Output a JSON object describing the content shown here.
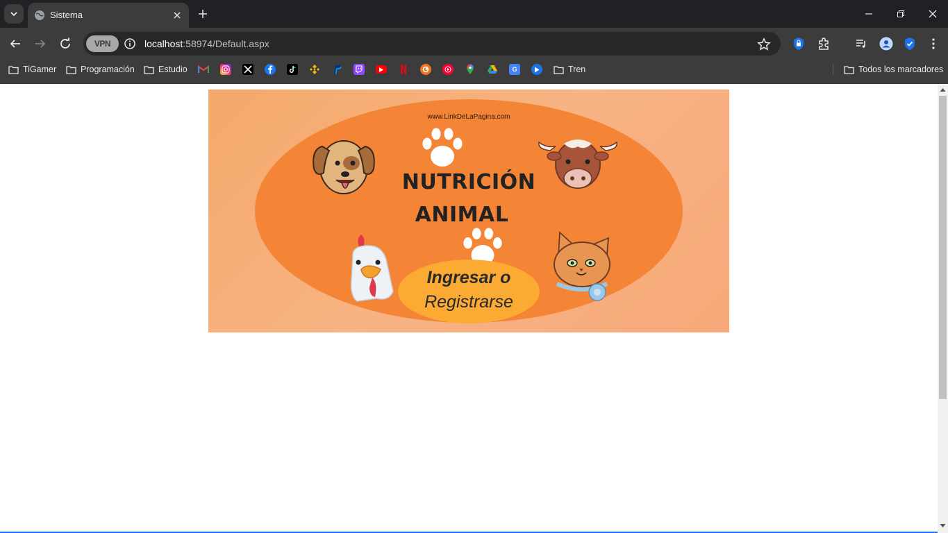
{
  "browser": {
    "tab": {
      "title": "Sistema"
    },
    "address": {
      "host": "localhost",
      "path": ":58974/Default.aspx"
    },
    "vpn_label": "VPN"
  },
  "bookmarks": {
    "folders": [
      "TiGamer",
      "Programación",
      "Estudio"
    ],
    "icons": [
      "gmail-icon",
      "instagram-icon",
      "x-icon",
      "facebook-icon",
      "tiktok-icon",
      "binance-icon",
      "paypal-icon",
      "twitch-icon",
      "youtube-icon",
      "netflix-icon",
      "crunchyroll-icon",
      "youtube-music-icon",
      "maps-icon",
      "drive-icon",
      "translate-icon",
      "play-icon"
    ],
    "tren": "Tren",
    "all": "Todos los marcadores"
  },
  "banner": {
    "site_link": "www.LinkDeLaPagina.com",
    "title_line1": "NUTRICIÓN",
    "title_line2": "ANIMAL",
    "cta_line1": "Ingresar o",
    "cta_line2": "Registrarse"
  },
  "colors": {
    "banner_bg": "#f8b383",
    "ellipse": "#f58536",
    "cta": "#fbab34"
  }
}
